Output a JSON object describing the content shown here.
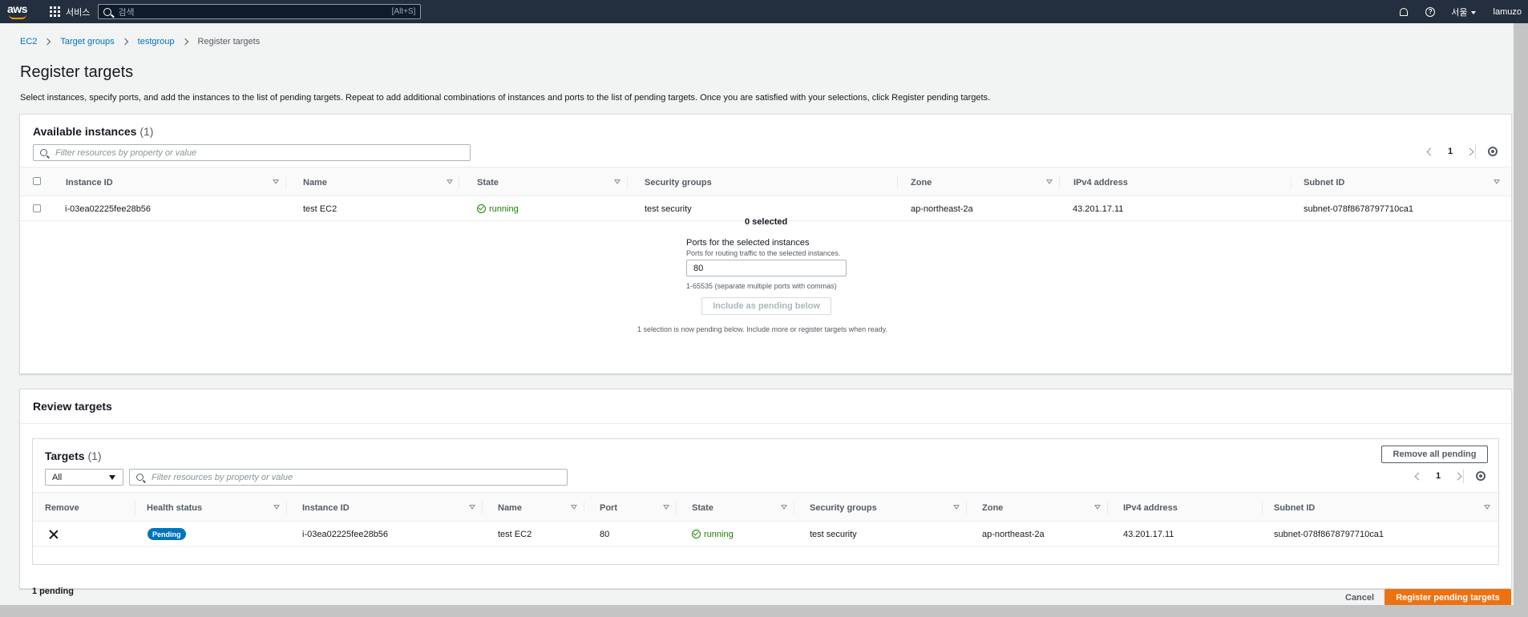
{
  "topnav": {
    "logo": "aws",
    "services_label": "서비스",
    "search_placeholder": "검색",
    "search_shortcut": "[Alt+S]",
    "region": "서울",
    "user": "lamuzo"
  },
  "breadcrumb": [
    "EC2",
    "Target groups",
    "testgroup",
    "Register targets"
  ],
  "page": {
    "title": "Register targets",
    "description": "Select instances, specify ports, and add the instances to the list of pending targets. Repeat to add additional combinations of instances and ports to the list of pending targets. Once you are satisfied with your selections, click Register pending targets."
  },
  "available": {
    "title": "Available instances",
    "count": "(1)",
    "filter_placeholder": "Filter resources by property or value",
    "page_num": "1",
    "columns": [
      "Instance ID",
      "Name",
      "State",
      "Security groups",
      "Zone",
      "IPv4 address",
      "Subnet ID"
    ],
    "rows": [
      {
        "instance_id": "i-03ea02225fee28b56",
        "name": "test EC2",
        "state": "running",
        "security_groups": "test security",
        "zone": "ap-northeast-2a",
        "ipv4": "43.201.17.11",
        "subnet": "subnet-078f8678797710ca1"
      }
    ],
    "selected_text": "0 selected",
    "ports_label": "Ports for the selected instances",
    "ports_desc": "Ports for routing traffic to the selected instances.",
    "ports_value": "80",
    "ports_hint": "1-65535 (separate multiple ports with commas)",
    "include_button": "Include as pending below",
    "pending_note": "1 selection is now pending below. Include more or register targets when ready."
  },
  "review": {
    "title": "Review targets",
    "targets_title": "Targets",
    "targets_count": "(1)",
    "remove_all_button": "Remove all pending",
    "select_value": "All",
    "filter_placeholder": "Filter resources by property or value",
    "page_num": "1",
    "columns": [
      "Remove",
      "Health status",
      "Instance ID",
      "Name",
      "Port",
      "State",
      "Security groups",
      "Zone",
      "IPv4 address",
      "Subnet ID"
    ],
    "rows": [
      {
        "health": "Pending",
        "instance_id": "i-03ea02225fee28b56",
        "name": "test EC2",
        "port": "80",
        "state": "running",
        "security_groups": "test security",
        "zone": "ap-northeast-2a",
        "ipv4": "43.201.17.11",
        "subnet": "subnet-078f8678797710ca1"
      }
    ]
  },
  "footer": {
    "pending": "1 pending",
    "cancel": "Cancel",
    "register": "Register pending targets"
  },
  "colors": {
    "nav_bg": "#232f3e",
    "link": "#0073bb",
    "primary": "#ec7211",
    "success": "#1d8102"
  }
}
